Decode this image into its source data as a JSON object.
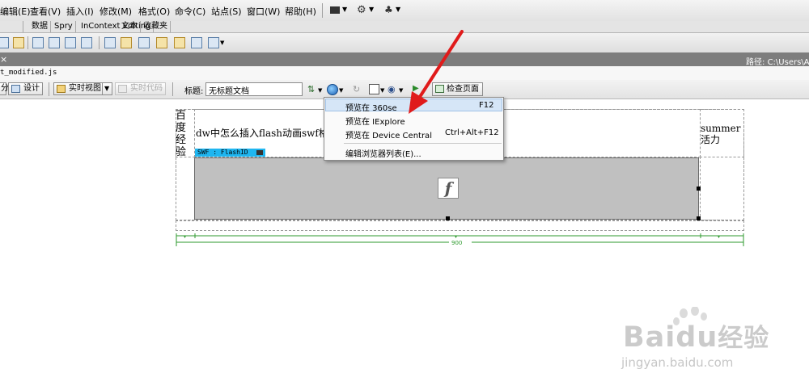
{
  "menubar": {
    "items": [
      "编辑(E)",
      "查看(V)",
      "插入(I)",
      "修改(M)",
      "格式(O)",
      "命令(C)",
      "站点(S)",
      "窗口(W)",
      "帮助(H)"
    ]
  },
  "insert_tabs": [
    "数据",
    "Spry",
    "InContext Editing",
    "文本",
    "收藏夹"
  ],
  "path_bar": {
    "label": "路径:",
    "value": "C:\\Users\\Adr"
  },
  "related_file": "t_modified.js",
  "document_toolbar": {
    "code_label": "分",
    "design_label": "设计",
    "live_view_label": "实时视图",
    "live_code_label": "实时代码",
    "title_label": "标题:",
    "title_value": "无标题文档",
    "check_page_label": "检查页面"
  },
  "design_view": {
    "left_cell_text": "百度经验",
    "main_text": "dw中怎么插入flash动画swf格式",
    "right_cell_text": "summer活力",
    "swf_tag_label": "SWF : FlashID",
    "ruler_width_label": "900"
  },
  "preview_menu": {
    "items": [
      {
        "label": "预览在 360se",
        "shortcut": "F12"
      },
      {
        "label": "预览在 IExplore",
        "shortcut": ""
      },
      {
        "label": "预览在 Device Central",
        "shortcut": "Ctrl+Alt+F12"
      },
      {
        "label": "编辑浏览器列表(E)...",
        "shortcut": ""
      }
    ]
  },
  "watermark": {
    "brand": "Bai",
    "brand_suffix": "du",
    "cn": "经验",
    "url": "jingyan.baidu.com"
  },
  "colors": {
    "swf_tag": "#1fb6f0",
    "ruler": "#2e9a2e",
    "arrow": "#e01b1b",
    "menu_highlight": "#d6e6f7"
  }
}
